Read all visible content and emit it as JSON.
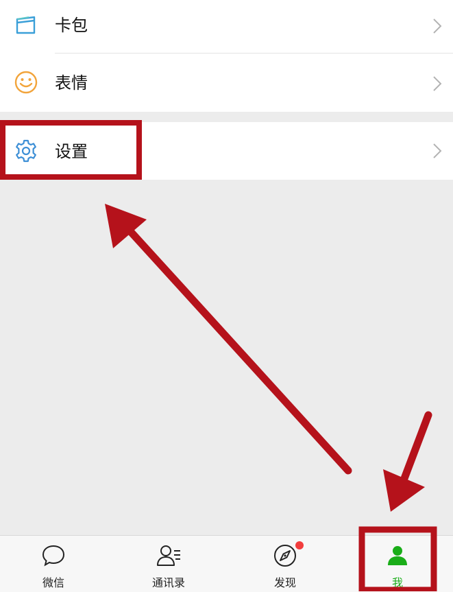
{
  "menu": {
    "card_wallet": {
      "label": "卡包",
      "icon": "card-wallet-icon"
    },
    "stickers": {
      "label": "表情",
      "icon": "smiley-icon"
    },
    "settings": {
      "label": "设置",
      "icon": "gear-icon"
    }
  },
  "tabbar": {
    "chats": {
      "label": "微信",
      "icon": "chat-bubble-icon"
    },
    "contacts": {
      "label": "通讯录",
      "icon": "contacts-icon"
    },
    "discover": {
      "label": "发现",
      "icon": "compass-icon",
      "has_badge": true
    },
    "me": {
      "label": "我",
      "icon": "me-icon",
      "selected": true
    }
  },
  "annotation": {
    "highlight_color": "#b5121b",
    "arrow_color": "#b5121b"
  },
  "colors": {
    "accent_green": "#1aad19",
    "icon_blue": "#3d8fd6",
    "icon_orange": "#f2a43b",
    "badge_red": "#f23d3d"
  }
}
